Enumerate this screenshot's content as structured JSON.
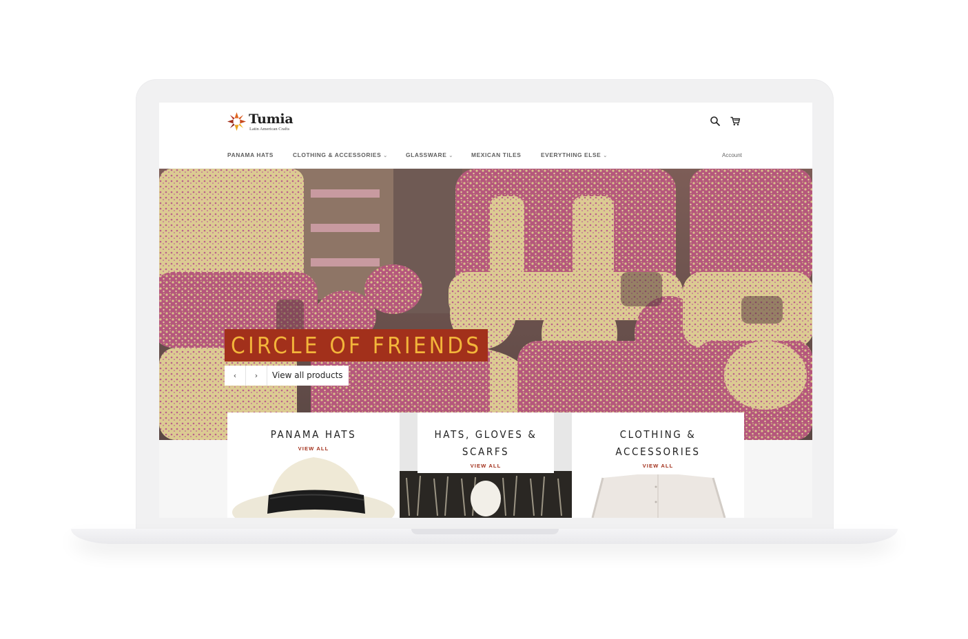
{
  "header": {
    "logo_name": "Tumia",
    "logo_tagline": "Latin American Crafts"
  },
  "nav": {
    "items": [
      {
        "label": "PANAMA HATS",
        "has_dropdown": false
      },
      {
        "label": "CLOTHING & ACCESSORIES",
        "has_dropdown": true
      },
      {
        "label": "GLASSWARE",
        "has_dropdown": true
      },
      {
        "label": "MEXICAN TILES",
        "has_dropdown": false
      },
      {
        "label": "EVERYTHING ELSE",
        "has_dropdown": true
      }
    ],
    "account_label": "Account"
  },
  "hero": {
    "title": "CIRCLE OF FRIENDS",
    "prev_glyph": "‹",
    "next_glyph": "›",
    "view_all_label": "View all products"
  },
  "collections": [
    {
      "title": "PANAMA HATS",
      "link": "VIEW ALL"
    },
    {
      "title_line1": "HATS, GLOVES &",
      "title_line2": "SCARFS",
      "link": "VIEW ALL"
    },
    {
      "title_line1": "CLOTHING &",
      "title_line2": "ACCESSORIES",
      "link": "VIEW ALL"
    }
  ],
  "colors": {
    "accent": "#a2301b",
    "hero_title_text": "#f3b53a",
    "nav_text": "#5e5e5e"
  },
  "icons": {
    "search": "search-icon",
    "cart": "cart-icon",
    "logo": "star-logo-icon"
  }
}
